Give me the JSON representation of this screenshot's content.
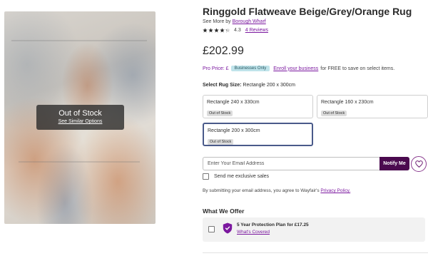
{
  "product": {
    "title": "Ringgold Flatweave Beige/Grey/Orange Rug",
    "see_more_prefix": "See More by",
    "brand": "Borough Wharf",
    "rating_value": "4.3",
    "rating": 4.3,
    "reviews_label": "4 Reviews",
    "price": "£202.99"
  },
  "image_overlay": {
    "status": "Out of Stock",
    "link": "See Similar Options"
  },
  "pro_price": {
    "label": "Pro Price: £",
    "badge": "Businesses Only",
    "link": "Enroll your business",
    "suffix": "for FREE to save on select items."
  },
  "rug_size": {
    "label": "Select Rug Size:",
    "selected_value": "Rectangle 200 x 300cm",
    "options": [
      {
        "label": "Rectangle 240 x 330cm",
        "status": "Out of Stock"
      },
      {
        "label": "Rectangle 160 x 230cm",
        "status": "Out of Stock"
      },
      {
        "label": "Rectangle 200 x 300cm",
        "status": "Out of Stock"
      }
    ]
  },
  "notify": {
    "placeholder": "Enter Your Email Address",
    "button": "Notify Me",
    "exclusive_label": "Send me exclusive sales",
    "disclaimer_prefix": "By submitting your email address, you agree to Wayfair's",
    "privacy_link": "Privacy Policy."
  },
  "offers": {
    "heading": "What We Offer",
    "plan_title": "5 Year Protection Plan for £17.25",
    "plan_link": "What's Covered"
  },
  "colors": {
    "accent_purple": "#7b189f",
    "button_dark": "#4b0a4f",
    "selected_border": "#4a5a8a",
    "badge_teal": "#bfe3ea"
  },
  "icons": [
    "star-icon",
    "heart-icon",
    "shield-icon",
    "checkbox-icon"
  ]
}
